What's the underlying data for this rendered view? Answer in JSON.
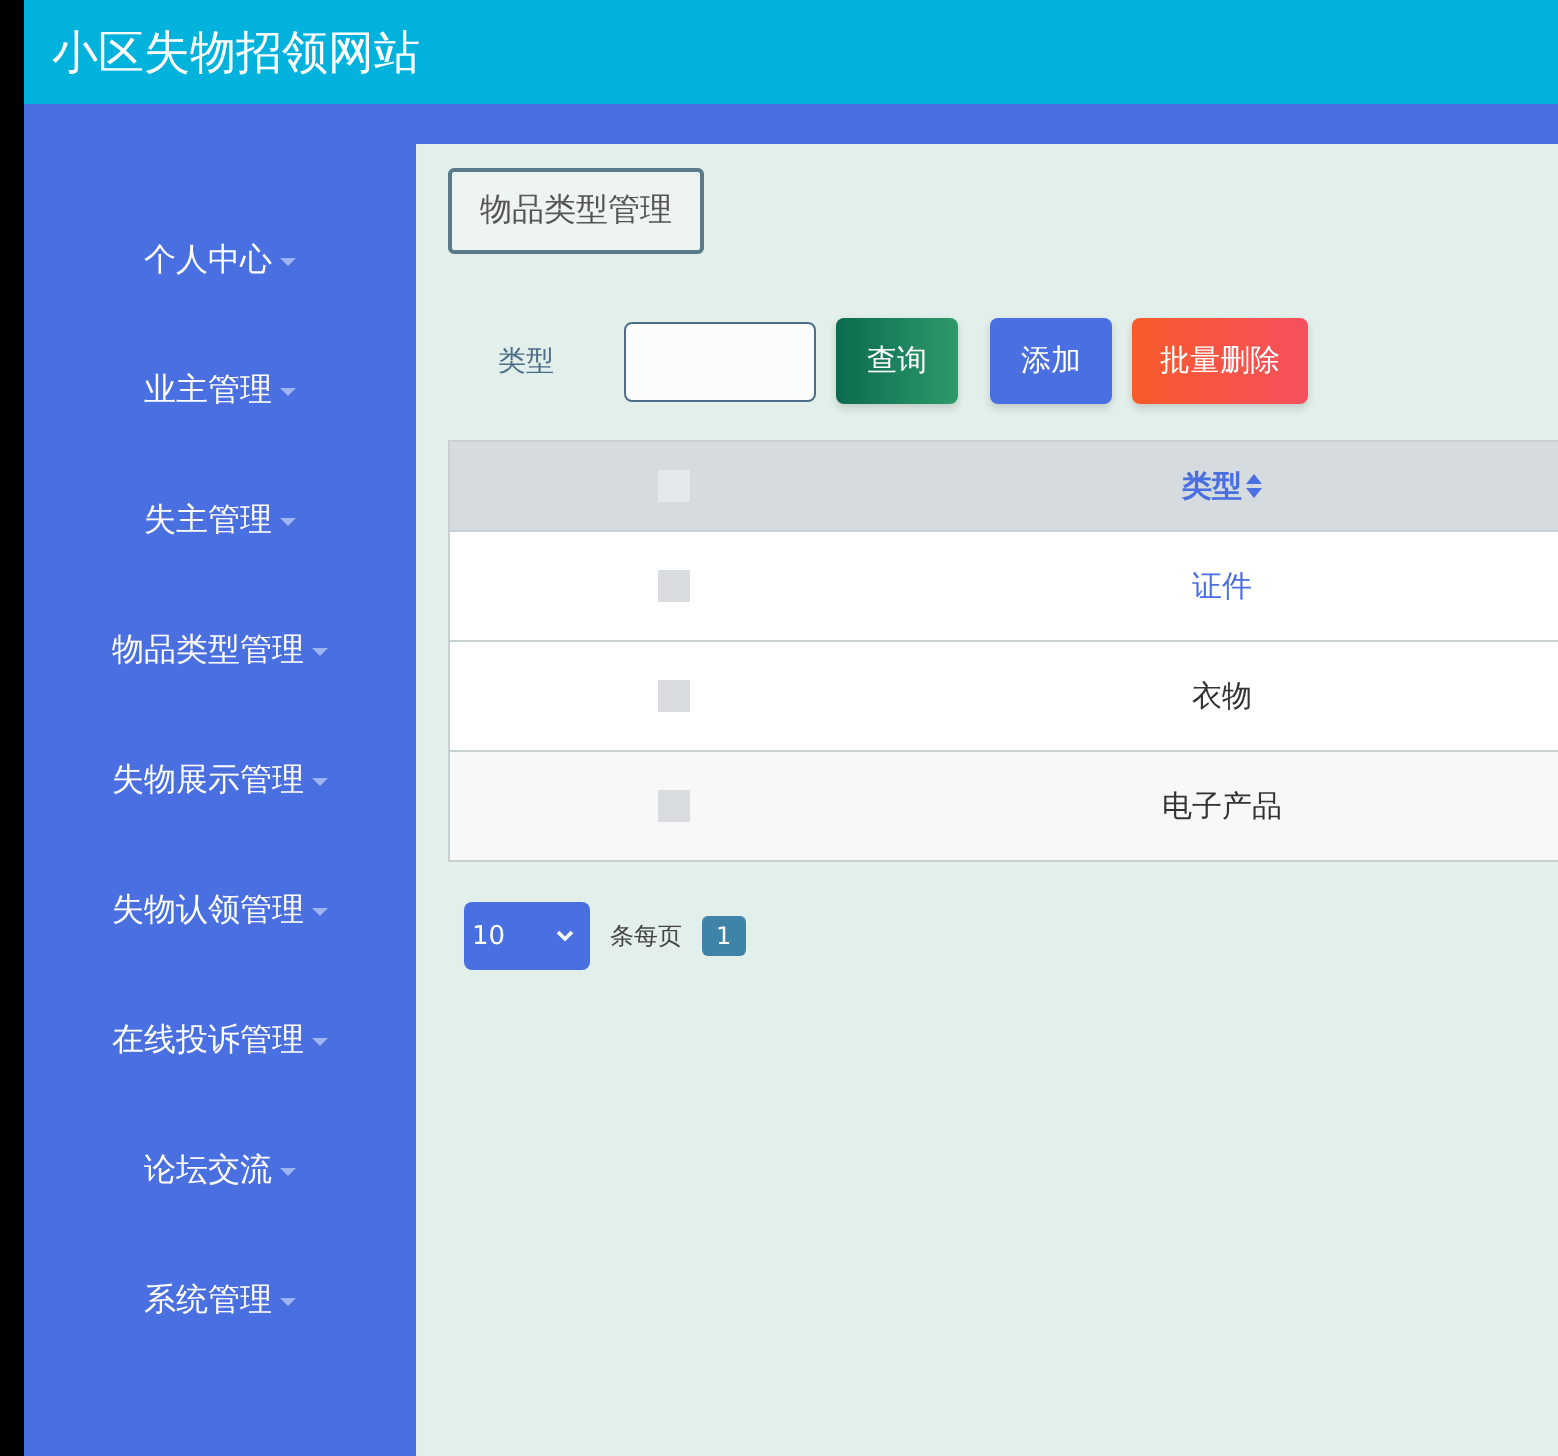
{
  "header": {
    "title": "小区失物招领网站"
  },
  "sidebar": {
    "items": [
      {
        "label": "个人中心"
      },
      {
        "label": "业主管理"
      },
      {
        "label": "失主管理"
      },
      {
        "label": "物品类型管理"
      },
      {
        "label": "失物展示管理"
      },
      {
        "label": "失物认领管理"
      },
      {
        "label": "在线投诉管理"
      },
      {
        "label": "论坛交流"
      },
      {
        "label": "系统管理"
      }
    ]
  },
  "breadcrumb": "物品类型管理",
  "search": {
    "label": "类型",
    "buttons": [
      {
        "label": "查询",
        "kind": "search"
      },
      {
        "label": "添加",
        "kind": "add"
      },
      {
        "label": "批量删除",
        "kind": "delete"
      }
    ]
  },
  "table": {
    "all_checked": false,
    "columns": [
      {
        "label": "类型"
      }
    ],
    "rows": [
      {
        "cells": [
          "证件"
        ],
        "checked": false,
        "highlighted": true
      },
      {
        "cells": [
          "衣物"
        ],
        "checked": false,
        "highlighted": false
      },
      {
        "cells": [
          "电子产品"
        ],
        "checked": false,
        "highlighted": false
      }
    ]
  },
  "pagination": {
    "page_size": "10",
    "per_page_label": "条每页",
    "pages": [
      {
        "label": "1",
        "selected": true
      }
    ]
  }
}
